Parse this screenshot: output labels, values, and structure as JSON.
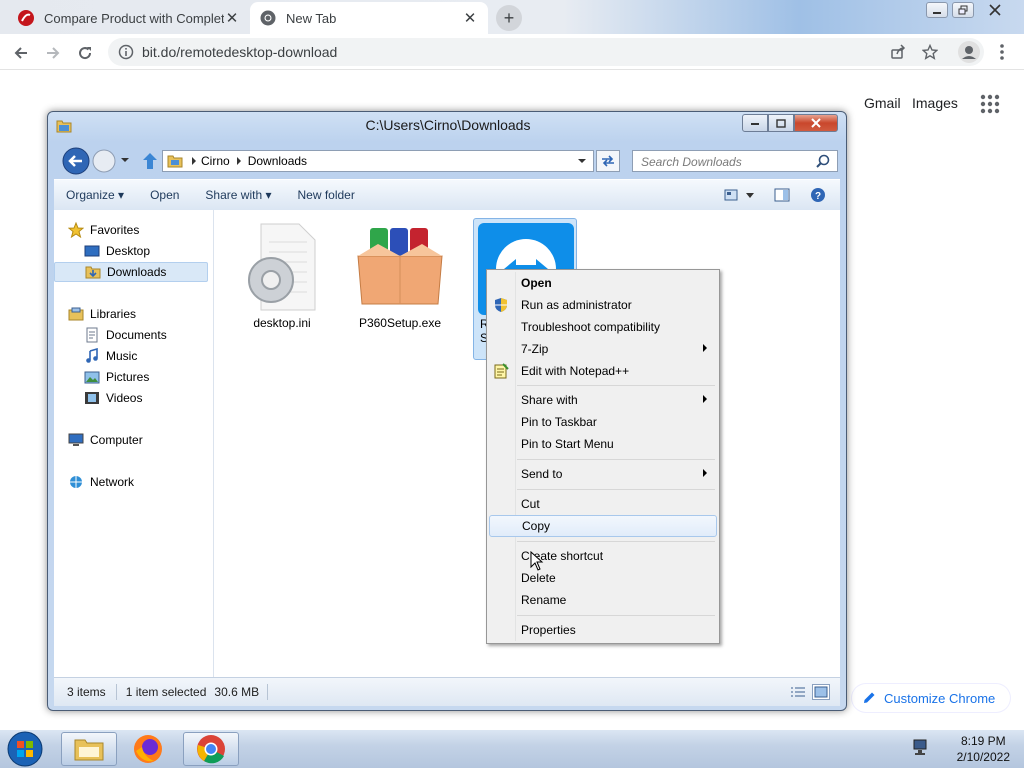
{
  "browser": {
    "tabs": [
      {
        "title": "Compare Product with Complete",
        "close": "✕"
      },
      {
        "title": "New Tab",
        "close": "✕"
      }
    ],
    "new_tab_symbol": "+",
    "url": "bit.do/remotedesktop-download",
    "newtab_page": {
      "links": [
        "Gmail",
        "Images"
      ],
      "customize_label": "Customize Chrome"
    }
  },
  "explorer": {
    "title": "C:\\Users\\Cirno\\Downloads",
    "breadcrumb": [
      "Cirno",
      "Downloads"
    ],
    "search_placeholder": "Search Downloads",
    "commands": [
      "Organize",
      "Open",
      "Share with",
      "New folder"
    ],
    "nav": {
      "favorites": {
        "label": "Favorites",
        "items": [
          "Desktop",
          "Downloads"
        ]
      },
      "libraries": {
        "label": "Libraries",
        "items": [
          "Documents",
          "Music",
          "Pictures",
          "Videos"
        ]
      },
      "computer": "Computer",
      "network": "Network"
    },
    "files": [
      {
        "name": "desktop.ini",
        "icon": "settings-file-icon"
      },
      {
        "name": "P360Setup.exe",
        "icon": "installer-box-icon"
      },
      {
        "name": "R\nS",
        "icon": "teamviewer-icon",
        "selected": true
      }
    ],
    "status": {
      "items": "3 items",
      "selected": "1 item selected",
      "size": "30.6 MB"
    }
  },
  "context_menu": {
    "items": [
      {
        "label": "Open",
        "bold": true
      },
      {
        "label": "Run as administrator",
        "icon": "uac-shield-icon"
      },
      {
        "label": "Troubleshoot compatibility"
      },
      {
        "label": "7-Zip",
        "submenu": true
      },
      {
        "label": "Edit with Notepad++",
        "icon": "notepad-plus-icon"
      },
      {
        "label": "Share with",
        "submenu": true
      },
      {
        "label": "Pin to Taskbar"
      },
      {
        "label": "Pin to Start Menu"
      },
      {
        "label": "Send to",
        "submenu": true
      },
      {
        "label": "Cut"
      },
      {
        "label": "Copy",
        "highlighted": true
      },
      {
        "label": "Create shortcut"
      },
      {
        "label": "Delete"
      },
      {
        "label": "Rename"
      },
      {
        "label": "Properties"
      }
    ]
  },
  "taskbar": {
    "time": "8:19 PM",
    "date": "2/10/2022"
  }
}
